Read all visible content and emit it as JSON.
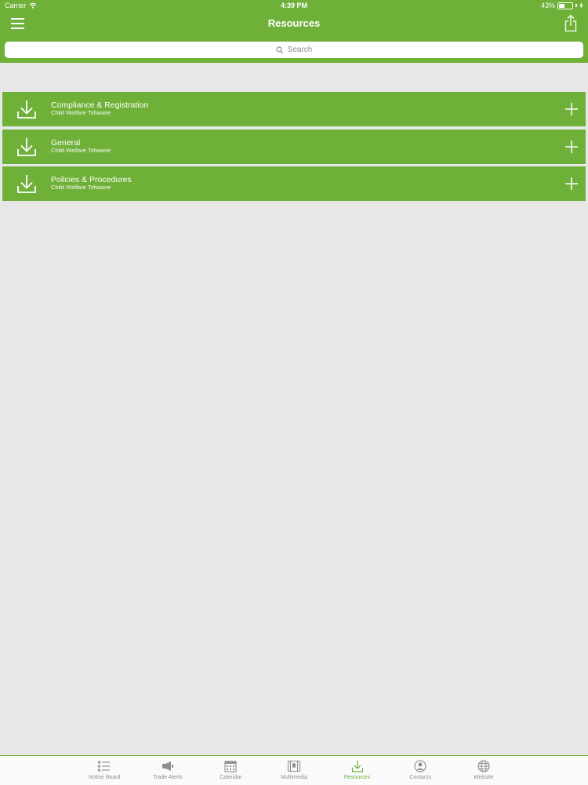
{
  "status": {
    "carrier": "Carrier",
    "time": "4:39 PM",
    "battery": "43%",
    "battery_level": 0.43
  },
  "nav": {
    "title": "Resources"
  },
  "search": {
    "placeholder": "Search"
  },
  "items": [
    {
      "title": "Compliance & Registration",
      "subtitle": "Child Welfare Tshwane"
    },
    {
      "title": "General",
      "subtitle": "Child Welfare Tshwane"
    },
    {
      "title": "Policies & Procedures",
      "subtitle": "Child Welfare Tshwane"
    }
  ],
  "tabs": [
    {
      "label": "Notice Board",
      "icon": "list-icon"
    },
    {
      "label": "Trade Alerts",
      "icon": "megaphone-icon"
    },
    {
      "label": "Calendar",
      "icon": "calendar-icon"
    },
    {
      "label": "Multimedia",
      "icon": "film-icon"
    },
    {
      "label": "Resources",
      "icon": "download-icon",
      "active": true
    },
    {
      "label": "Contacts",
      "icon": "contact-icon"
    },
    {
      "label": "Website",
      "icon": "globe-icon"
    }
  ],
  "colors": {
    "accent": "#6fb038",
    "background": "#e8e7e8",
    "inactive_tab": "#8e8e93"
  }
}
